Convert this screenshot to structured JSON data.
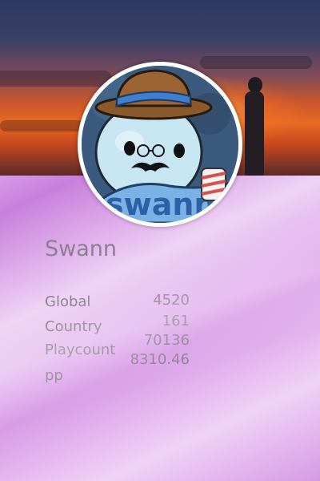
{
  "profile": {
    "username": "Swann",
    "avatar_caption": "swann",
    "banner": "sunset-silhouette-banner"
  },
  "stats": [
    {
      "label": "Global",
      "value": "4520"
    },
    {
      "label": "Country",
      "value": "161"
    },
    {
      "label": "Playcount",
      "value": "70136"
    },
    {
      "label": "pp",
      "value": "8310.46"
    }
  ],
  "colors": {
    "card_gradient_start": "#dcaee9",
    "card_gradient_mid": "#c97fdc",
    "text": "#8b7d8f",
    "avatar_border": "#ffffff"
  }
}
